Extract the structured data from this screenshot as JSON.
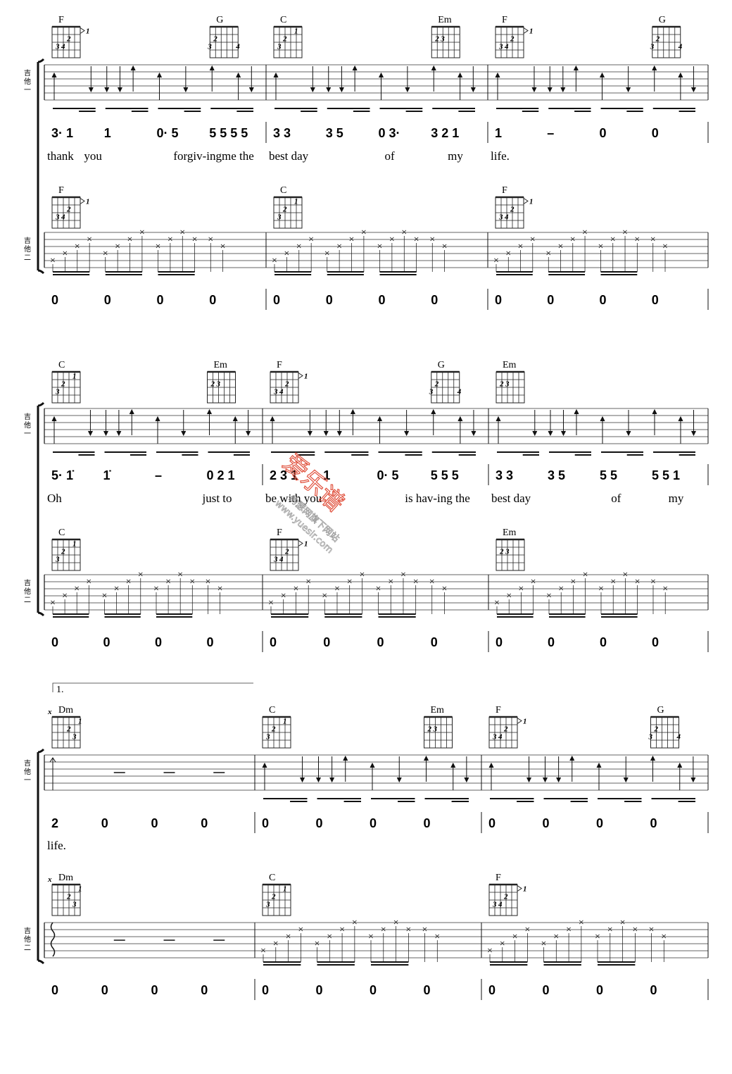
{
  "instruments": [
    "吉他一",
    "吉他二"
  ],
  "volta_label": "1.",
  "watermark": {
    "logo": "爱乐谱",
    "subtitle": "约瑟网旗下网站",
    "url": "www.yuesir.com"
  },
  "chord_shapes": {
    "F": {
      "barre": "1",
      "fingers": [
        {
          "string": 5,
          "fret": 3,
          "n": "3"
        },
        {
          "string": 4,
          "fret": 3,
          "n": "4"
        },
        {
          "string": 3,
          "fret": 2,
          "n": "2"
        }
      ]
    },
    "G": {
      "fingers": [
        {
          "string": 6,
          "fret": 3,
          "n": "3"
        },
        {
          "string": 5,
          "fret": 2,
          "n": "2"
        },
        {
          "string": 1,
          "fret": 3,
          "n": "4"
        }
      ]
    },
    "C": {
      "fingers": [
        {
          "string": 5,
          "fret": 3,
          "n": "3"
        },
        {
          "string": 4,
          "fret": 2,
          "n": "2"
        },
        {
          "string": 2,
          "fret": 1,
          "n": "1"
        }
      ]
    },
    "Em": {
      "fingers": [
        {
          "string": 5,
          "fret": 2,
          "n": "2"
        },
        {
          "string": 4,
          "fret": 2,
          "n": "3"
        }
      ]
    },
    "Dm": {
      "muted": "x",
      "fingers": [
        {
          "string": 3,
          "fret": 2,
          "n": "2"
        },
        {
          "string": 2,
          "fret": 3,
          "n": "3"
        },
        {
          "string": 1,
          "fret": 1,
          "n": "1"
        }
      ]
    }
  },
  "systems": [
    {
      "measures": [
        {
          "g1_chords": [
            {
              "name": "F",
              "beat": 0
            },
            {
              "name": "G",
              "beat": 3
            }
          ],
          "g2_chords": [
            {
              "name": "F",
              "beat": 0
            }
          ],
          "notation": [
            "3·   1",
            "1",
            "0·   5",
            "5 5 5 5"
          ],
          "lyrics": [
            {
              "beat": 0,
              "text": "thank"
            },
            {
              "beat": 0.7,
              "text": "you"
            },
            {
              "beat": 2.4,
              "text": "forgiv-ingme the"
            }
          ],
          "g2_notation": [
            "0",
            "0",
            "0",
            "0"
          ]
        },
        {
          "g1_chords": [
            {
              "name": "C",
              "beat": 0
            },
            {
              "name": "Em",
              "beat": 3
            }
          ],
          "g2_chords": [
            {
              "name": "C",
              "beat": 0
            }
          ],
          "notation": [
            "3   3",
            "3   5",
            "0 3·",
            "3   2 1"
          ],
          "lyrics": [
            {
              "beat": 0,
              "text": "best day"
            },
            {
              "beat": 2.2,
              "text": "of"
            },
            {
              "beat": 3.4,
              "text": "my"
            }
          ],
          "g2_notation": [
            "0",
            "0",
            "0",
            "0"
          ]
        },
        {
          "g1_chords": [
            {
              "name": "F",
              "beat": 0
            },
            {
              "name": "G",
              "beat": 3
            }
          ],
          "g2_chords": [
            {
              "name": "F",
              "beat": 0
            }
          ],
          "notation": [
            "1",
            "–",
            "0",
            "0"
          ],
          "lyrics": [
            {
              "beat": 0,
              "text": "life."
            }
          ],
          "g2_notation": [
            "0",
            "0",
            "0",
            "0"
          ]
        }
      ]
    },
    {
      "measures": [
        {
          "g1_chords": [
            {
              "name": "C",
              "beat": 0
            },
            {
              "name": "Em",
              "beat": 3
            }
          ],
          "g2_chords": [
            {
              "name": "C",
              "beat": 0
            }
          ],
          "notation": [
            "5·   1̇",
            "1̇",
            "–",
            "0 2   1"
          ],
          "lyrics": [
            {
              "beat": 0,
              "text": "Oh"
            },
            {
              "beat": 3,
              "text": "just  to"
            }
          ],
          "g2_notation": [
            "0",
            "0",
            "0",
            "0"
          ]
        },
        {
          "g1_chords": [
            {
              "name": "F",
              "beat": 0
            },
            {
              "name": "G",
              "beat": 3
            }
          ],
          "g2_chords": [
            {
              "name": "F",
              "beat": 0
            }
          ],
          "notation": [
            "2   3 1",
            "1",
            "0·   5",
            "5   5   5"
          ],
          "lyrics": [
            {
              "beat": 0,
              "text": "be with you"
            },
            {
              "beat": 2.6,
              "text": "is hav-ing the"
            }
          ],
          "g2_notation": [
            "0",
            "0",
            "0",
            "0"
          ]
        },
        {
          "g1_chords": [
            {
              "name": "Em",
              "beat": 0
            }
          ],
          "g2_chords": [
            {
              "name": "Em",
              "beat": 0
            }
          ],
          "notation": [
            "3   3",
            "3   5",
            "5   5",
            "5   5 1"
          ],
          "lyrics": [
            {
              "beat": 0,
              "text": "best day"
            },
            {
              "beat": 2.3,
              "text": "of"
            },
            {
              "beat": 3.4,
              "text": "my"
            }
          ],
          "g2_notation": [
            "0",
            "0",
            "0",
            "0"
          ]
        }
      ]
    },
    {
      "measures": [
        {
          "g1_chords": [
            {
              "name": "Dm",
              "beat": 0
            }
          ],
          "g2_chords": [
            {
              "name": "Dm",
              "beat": 0
            }
          ],
          "rest": true,
          "notation": [
            "2",
            "0",
            "0",
            "0"
          ],
          "lyrics": [
            {
              "beat": 0,
              "text": "life."
            }
          ],
          "g2_notation": [
            "0",
            "0",
            "0",
            "0"
          ]
        },
        {
          "g1_chords": [
            {
              "name": "C",
              "beat": 0
            },
            {
              "name": "Em",
              "beat": 3
            }
          ],
          "g2_chords": [
            {
              "name": "C",
              "beat": 0
            }
          ],
          "notation": [
            "0",
            "0",
            "0",
            "0"
          ],
          "lyrics": [],
          "g2_notation": [
            "0",
            "0",
            "0",
            "0"
          ]
        },
        {
          "g1_chords": [
            {
              "name": "F",
              "beat": 0
            },
            {
              "name": "G",
              "beat": 3
            }
          ],
          "g2_chords": [
            {
              "name": "F",
              "beat": 0
            }
          ],
          "notation": [
            "0",
            "0",
            "0",
            "0"
          ],
          "lyrics": [],
          "g2_notation": [
            "0",
            "0",
            "0",
            "0"
          ]
        }
      ]
    }
  ]
}
